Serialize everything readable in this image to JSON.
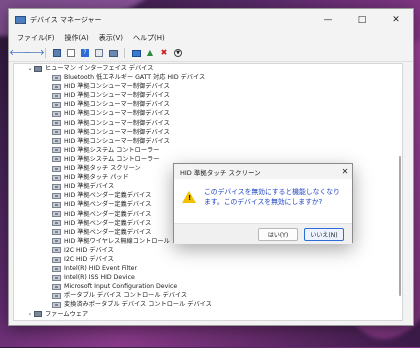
{
  "window": {
    "title": "デバイス マネージャー"
  },
  "menu": [
    "ファイル(F)",
    "操作(A)",
    "表示(V)",
    "ヘルプ(H)"
  ],
  "toolbar_icons": [
    "back-arrow-icon",
    "forward-arrow-icon",
    "properties-grid-icon",
    "list-view-icon",
    "device-view-icon",
    "help-icon",
    "hidden-devices-icon",
    "computer-icon",
    "scan-hardware-icon",
    "update-driver-icon",
    "remove-device-icon",
    "download-icon"
  ],
  "tree": {
    "category": "ヒューマン インターフェイス デバイス",
    "children": [
      "Bluetooth 低エネルギー GATT 対応 HID デバイス",
      "HID 準拠コンシューマー制御デバイス",
      "HID 準拠コンシューマー制御デバイス",
      "HID 準拠コンシューマー制御デバイス",
      "HID 準拠コンシューマー制御デバイス",
      "HID 準拠コンシューマー制御デバイス",
      "HID 準拠コンシューマー制御デバイス",
      "HID 準拠コンシューマー制御デバイス",
      "HID 準拠システム コントローラー",
      "HID 準拠システム コントローラー",
      "HID 準拠タッチ スクリーン",
      "HID 準拠タッチ パッド",
      "HID 準拠デバイス",
      "HID 準拠ベンダー定義デバイス",
      "HID 準拠ベンダー定義デバイス",
      "HID 準拠ベンダー定義デバイス",
      "HID 準拠ベンダー定義デバイス",
      "HID 準拠ベンダー定義デバイス",
      "HID 準拠ワイヤレス無線コントロール",
      "I2C HID デバイス",
      "I2C HID デバイス",
      "Intel(R) HID Event Filter",
      "Intel(R) ISS HID Device",
      "Microsoft Input Configuration Device",
      "ポータブル デバイス コントロール デバイス",
      "変換済みポータブル デバイス コントロール デバイス"
    ],
    "next_category": "ファームウェア"
  },
  "dialog": {
    "title": "HID 準拠タッチ スクリーン",
    "message": "このデバイスを無効にすると機能しなくなります。このデバイスを無効にしますか?",
    "yes_label": "はい(Y)",
    "no_label": "いいえ(N)"
  }
}
